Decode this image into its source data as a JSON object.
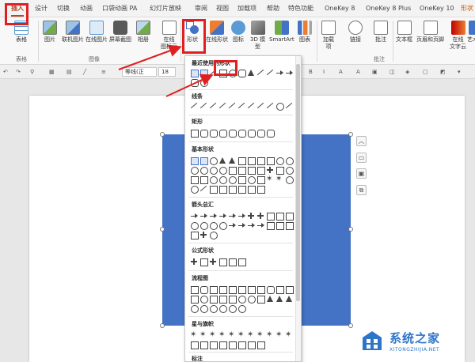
{
  "menu_tabs": [
    {
      "label": "插入",
      "active": true
    },
    {
      "label": "设计"
    },
    {
      "label": "切换"
    },
    {
      "label": "动画"
    },
    {
      "label": "口袋动画 PA"
    },
    {
      "label": "幻灯片放映"
    },
    {
      "label": "审阅"
    },
    {
      "label": "视图"
    },
    {
      "label": "加载项"
    },
    {
      "label": "帮助"
    },
    {
      "label": "特色功能"
    },
    {
      "label": "OneKey 8"
    },
    {
      "label": "OneKey 8 Plus"
    },
    {
      "label": "OneKey 10"
    },
    {
      "label": "形状"
    }
  ],
  "ribbon": {
    "buttons": {
      "table": "表格",
      "picture": "图片",
      "online_picture": "联机图片",
      "online_picture2": "在线图片",
      "screenshot": "屏幕截图",
      "album": "相册",
      "online_icon_line1": "在线",
      "online_icon_line2": "图标示",
      "shapes": "形状",
      "online_shapes": "在线形状",
      "icons": "图标",
      "model_line1": "3D 模",
      "model_line2": "型",
      "smartart": "SmartArt",
      "chart": "图表",
      "addins_line1": "加载",
      "addins_line2": "项",
      "link": "链接",
      "comment": "批注",
      "textbox": "文本框",
      "header_footer": "页眉和页脚",
      "art_text": "艺术",
      "online_text_line1": "在线",
      "online_text_line2": "文字云"
    },
    "groups": {
      "tables": "表格",
      "images": "图像",
      "comments": "批注"
    }
  },
  "qat": {
    "font_name": "等线(正",
    "font_size": "18"
  },
  "dropdown": {
    "sections": [
      {
        "title": "最近使用的形状"
      },
      {
        "title": "线条"
      },
      {
        "title": "矩形"
      },
      {
        "title": "基本形状"
      },
      {
        "title": "箭头总汇"
      },
      {
        "title": "公式形状"
      },
      {
        "title": "流程图"
      },
      {
        "title": "星与旗帜"
      },
      {
        "title": "标注"
      }
    ]
  },
  "watermark": {
    "title": "系统之家",
    "url": "XITONGZHIJIA.NET"
  },
  "colors": {
    "accent": "#b7472a",
    "shape_fill": "#4472c4",
    "annotation": "#e02020",
    "watermark": "#2e75c9"
  }
}
